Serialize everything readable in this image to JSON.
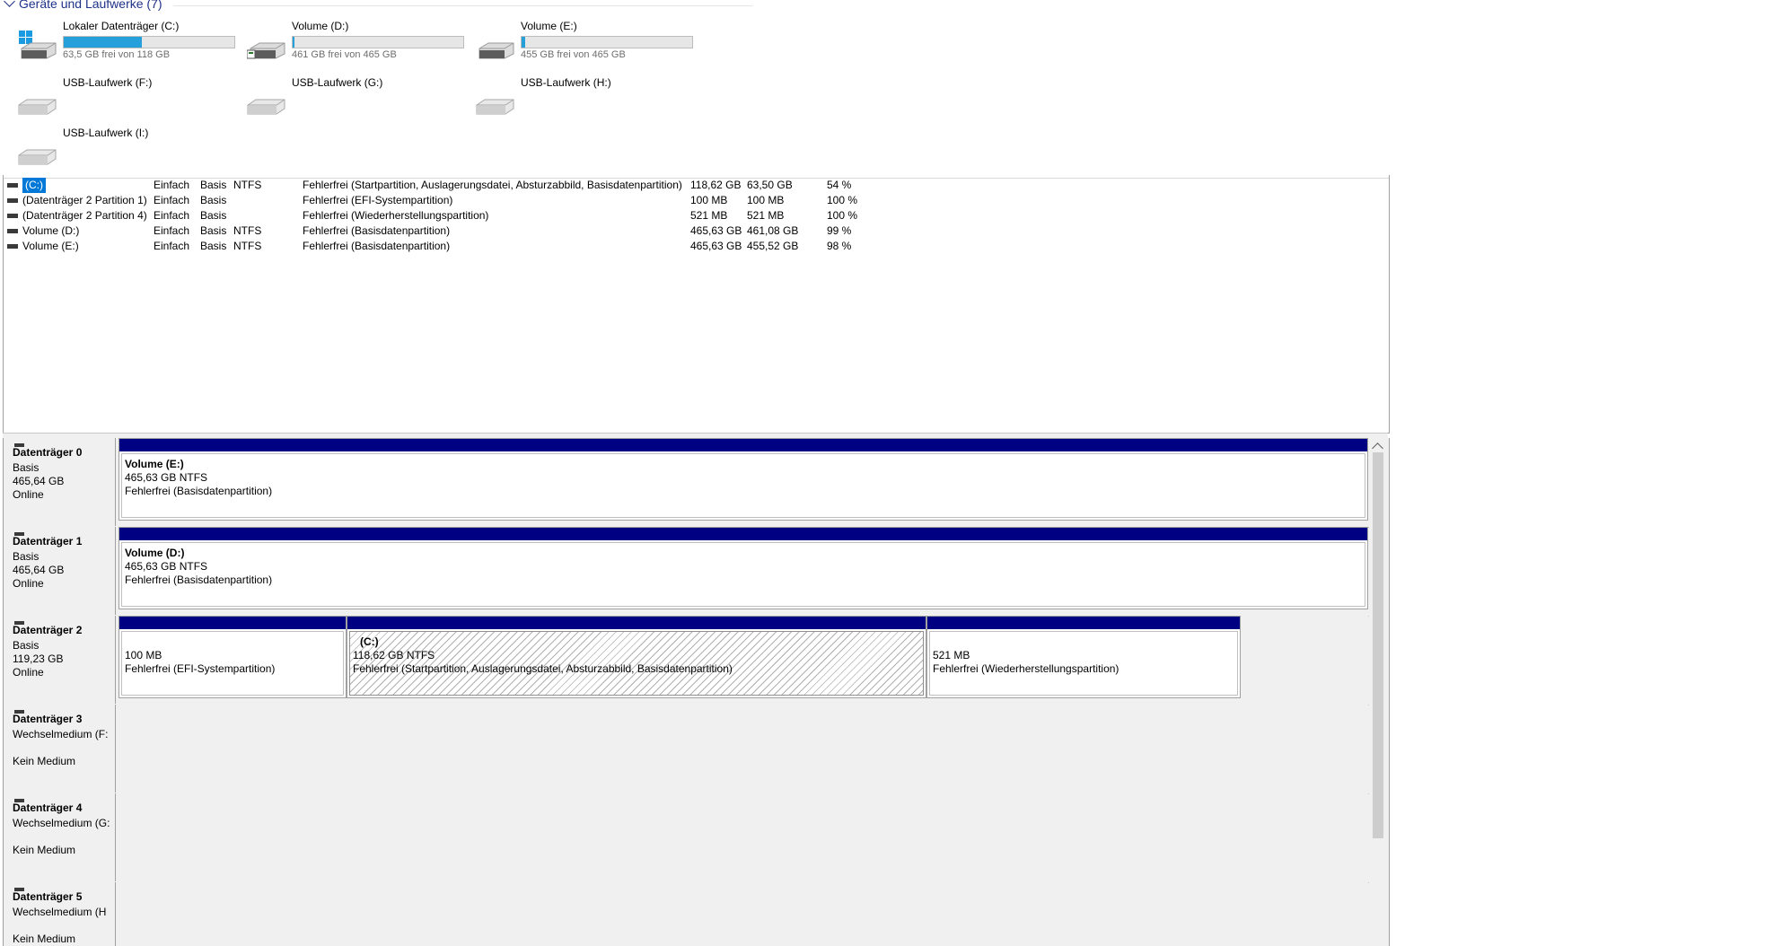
{
  "explorer": {
    "group_title": "Geräte und Laufwerke (7)",
    "drives": [
      {
        "name": "Lokaler Datenträger (C:)",
        "free": "63,5 GB frei von 118 GB",
        "used_fraction": 0.46,
        "icon": "windows-drive-icon"
      },
      {
        "name": "Volume (D:)",
        "free": "461 GB frei von 465 GB",
        "used_fraction": 0.01,
        "icon": "hdd-icon"
      },
      {
        "name": "Volume (E:)",
        "free": "455 GB frei von 465 GB",
        "used_fraction": 0.02,
        "icon": "hdd-icon"
      },
      {
        "name": "USB-Laufwerk (F:)",
        "icon": "usb-drive-icon"
      },
      {
        "name": "USB-Laufwerk (G:)",
        "icon": "usb-drive-icon"
      },
      {
        "name": "USB-Laufwerk (H:)",
        "icon": "usb-drive-icon"
      },
      {
        "name": "USB-Laufwerk (I:)",
        "icon": "usb-drive-icon"
      }
    ]
  },
  "volume_list": {
    "rows": [
      {
        "name": "(C:)",
        "layout": "Einfach",
        "type": "Basis",
        "fs": "NTFS",
        "status": "Fehlerfrei (Startpartition, Auslagerungsdatei, Absturzabbild, Basisdatenpartition)",
        "capacity": "118,62 GB",
        "free": "63,50 GB",
        "pct": "54 %"
      },
      {
        "name": "(Datenträger 2 Partition 1)",
        "layout": "Einfach",
        "type": "Basis",
        "fs": "",
        "status": "Fehlerfrei (EFI-Systempartition)",
        "capacity": "100 MB",
        "free": "100 MB",
        "pct": "100 %"
      },
      {
        "name": "(Datenträger 2 Partition 4)",
        "layout": "Einfach",
        "type": "Basis",
        "fs": "",
        "status": "Fehlerfrei (Wiederherstellungspartition)",
        "capacity": "521 MB",
        "free": "521 MB",
        "pct": "100 %"
      },
      {
        "name": "Volume (D:)",
        "layout": "Einfach",
        "type": "Basis",
        "fs": "NTFS",
        "status": "Fehlerfrei (Basisdatenpartition)",
        "capacity": "465,63 GB",
        "free": "461,08 GB",
        "pct": "99 %"
      },
      {
        "name": "Volume (E:)",
        "layout": "Einfach",
        "type": "Basis",
        "fs": "NTFS",
        "status": "Fehlerfrei (Basisdatenpartition)",
        "capacity": "465,63 GB",
        "free": "455,52 GB",
        "pct": "98 %"
      }
    ]
  },
  "disks": [
    {
      "title": "Datenträger 0",
      "line1": "Basis",
      "line2": "465,64 GB",
      "line3": "Online",
      "partitions": [
        {
          "title": "Volume  (E:)",
          "size": "465,63 GB NTFS",
          "status": "Fehlerfrei (Basisdatenpartition)"
        }
      ]
    },
    {
      "title": "Datenträger 1",
      "line1": "Basis",
      "line2": "465,64 GB",
      "line3": "Online",
      "partitions": [
        {
          "title": "Volume  (D:)",
          "size": "465,63 GB NTFS",
          "status": "Fehlerfrei (Basisdatenpartition)"
        }
      ]
    },
    {
      "title": "Datenträger 2",
      "line1": "Basis",
      "line2": "119,23 GB",
      "line3": "Online",
      "partitions": [
        {
          "title": "",
          "size": "100 MB",
          "status": "Fehlerfrei (EFI-Systempartition)"
        },
        {
          "title": "(C:)",
          "size": "118,62 GB NTFS",
          "status": "Fehlerfrei (Startpartition, Auslagerungsdatei, Absturzabbild, Basisdatenpartition)"
        },
        {
          "title": "",
          "size": "521 MB",
          "status": "Fehlerfrei (Wiederherstellungspartition)"
        }
      ]
    },
    {
      "title": "Datenträger 3",
      "line1": "Wechselmedium (F:",
      "line3": "Kein Medium"
    },
    {
      "title": "Datenträger 4",
      "line1": "Wechselmedium (G:",
      "line3": "Kein Medium"
    },
    {
      "title": "Datenträger 5",
      "line1": "Wechselmedium (H",
      "line3": "Kein Medium"
    }
  ]
}
